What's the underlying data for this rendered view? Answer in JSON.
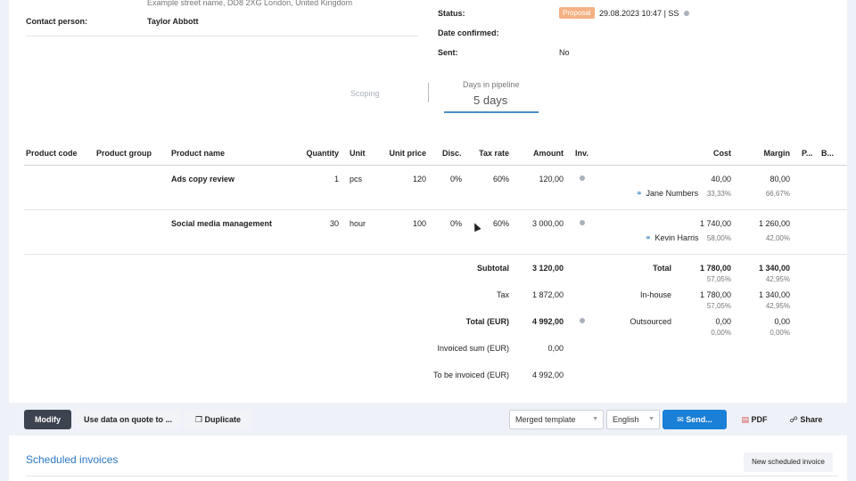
{
  "contact": {
    "address": "Example street name, DD8 2XG London, United Kingdom",
    "person_label": "Contact person:",
    "person_value": "Taylor Abbott"
  },
  "status": {
    "status_label": "Status:",
    "badge": "Proposal",
    "timestamp": "29.08.2023 10:47 | SS",
    "date_confirmed_label": "Date confirmed:",
    "sent_label": "Sent:",
    "sent_value": "No"
  },
  "pipeline": {
    "stage": "Scoping",
    "days_label": "Days in pipeline",
    "days_value": "5 days"
  },
  "table": {
    "headers": {
      "product_code": "Product code",
      "product_group": "Product group",
      "product_name": "Product name",
      "quantity": "Quantity",
      "unit": "Unit",
      "unit_price": "Unit price",
      "disc": "Disc.",
      "tax_rate": "Tax rate",
      "amount": "Amount",
      "inv": "Inv.",
      "cost": "Cost",
      "margin": "Margin",
      "p": "P...",
      "b": "B..."
    },
    "rows": [
      {
        "name": "Ads copy review",
        "quantity": "1",
        "unit": "pcs",
        "unit_price": "120",
        "disc": "0%",
        "tax_rate": "60%",
        "amount": "120,00",
        "cost": "40,00",
        "margin": "80,00",
        "person": "Jane Numbers",
        "cost_pct": "33,33%",
        "margin_pct": "66,67%"
      },
      {
        "name": "Social media management",
        "quantity": "30",
        "unit": "hour",
        "unit_price": "100",
        "disc": "0%",
        "tax_rate": "60%",
        "amount": "3 000,00",
        "cost": "1 740,00",
        "margin": "1 260,00",
        "person": "Kevin Harris",
        "cost_pct": "58,00%",
        "margin_pct": "42,00%"
      }
    ]
  },
  "totals": {
    "subtotal_label": "Subtotal",
    "subtotal_value": "3 120,00",
    "tax_label": "Tax",
    "tax_value": "1 872,00",
    "total_label": "Total (EUR)",
    "total_value": "4 992,00",
    "invoiced_label": "Invoiced sum (EUR)",
    "invoiced_value": "0,00",
    "to_invoice_label": "To be invoiced (EUR)",
    "to_invoice_value": "4 992,00"
  },
  "cost_summary": {
    "total_label": "Total",
    "total_cost": "1 780,00",
    "total_margin": "1 340,00",
    "total_cost_pct": "57,05%",
    "total_margin_pct": "42,95%",
    "inhouse_label": "In-house",
    "inhouse_cost": "1 780,00",
    "inhouse_margin": "1 340,00",
    "inhouse_cost_pct": "57,05%",
    "inhouse_margin_pct": "42,95%",
    "outsourced_label": "Outsourced",
    "outsourced_cost": "0,00",
    "outsourced_margin": "0,00",
    "outsourced_cost_pct": "0,00%",
    "outsourced_margin_pct": "0,00%"
  },
  "toolbar": {
    "modify": "Modify",
    "use_data": "Use data on quote to ...",
    "duplicate": "Duplicate",
    "template": "Merged template",
    "language": "English",
    "send": "Send...",
    "pdf": "PDF",
    "share": "Share"
  },
  "scheduled": {
    "title": "Scheduled invoices",
    "new_button": "New scheduled invoice"
  },
  "colors": {
    "badge": "#f4b183",
    "primary": "#1a7fd6",
    "dark_button": "#3d434f",
    "link": "#2b78c2"
  }
}
